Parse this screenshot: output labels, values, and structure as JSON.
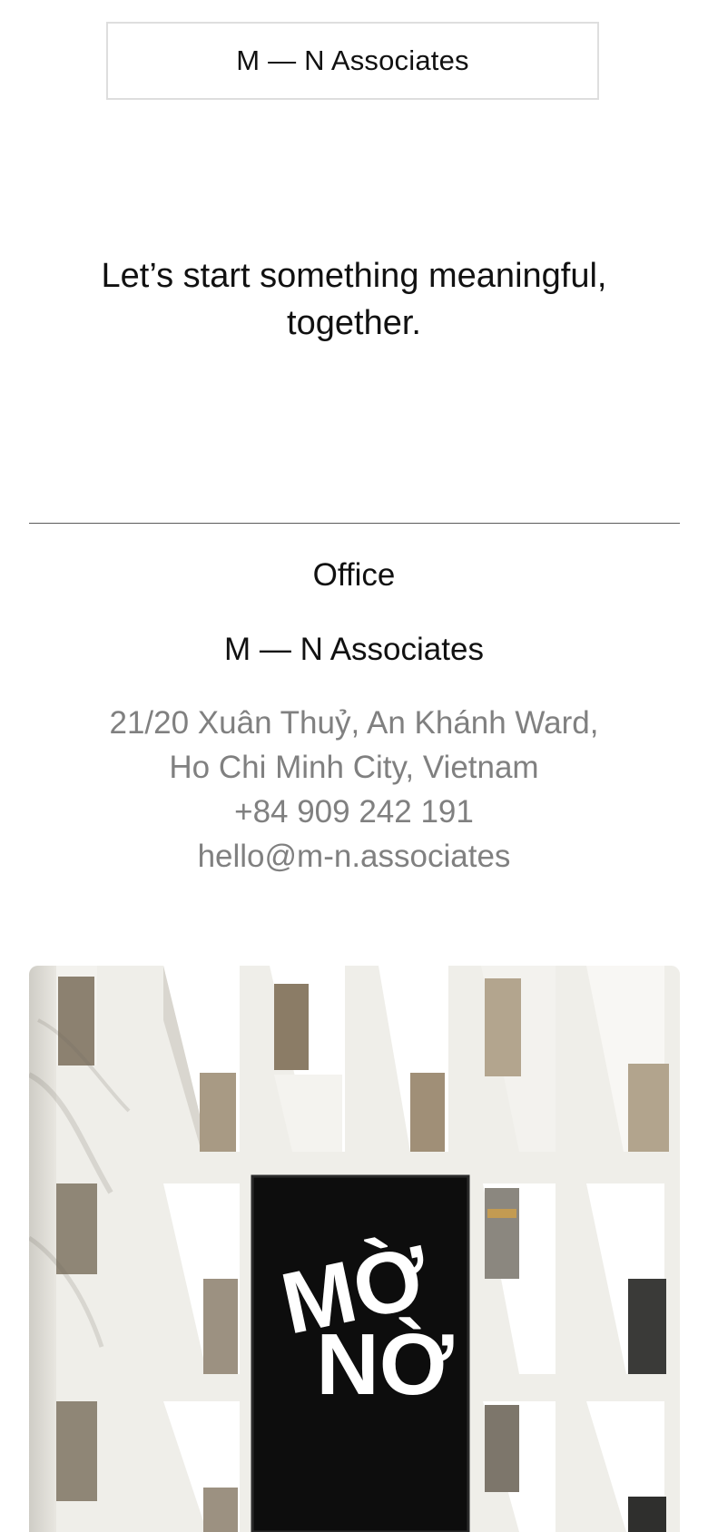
{
  "header": {
    "brand_label": "M — N Associates"
  },
  "hero": {
    "headline": "Let’s start something meaningful, together."
  },
  "office": {
    "heading": "Office",
    "company": "M — N Associates",
    "address_line_1": "21/20 Xuân Thuỷ, An Khánh Ward,",
    "address_line_2": "Ho Chi Minh City, Vietnam",
    "phone": "+84 909 242 191",
    "email": "hello@m-n.associates"
  },
  "photo": {
    "sign_text_line_1": "MỜ",
    "sign_text_line_2": "NỜ"
  },
  "colors": {
    "text": "#111111",
    "muted_text": "#808080",
    "divider": "#5a5a5a",
    "box_border": "#dedede",
    "wall": "#ecebe6",
    "sign": "#0d0d0d"
  }
}
